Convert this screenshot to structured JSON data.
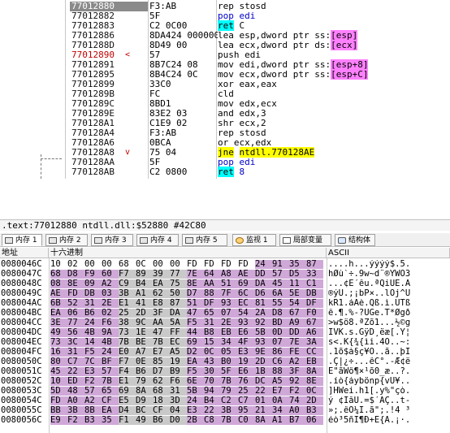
{
  "disassembly": {
    "rows": [
      {
        "addr": "77012880",
        "hex": "F3:AB",
        "ins": [
          [
            "rep stosd",
            ""
          ]
        ],
        "sel": true
      },
      {
        "addr": "77012882",
        "hex": "5F",
        "ins": [
          [
            "pop ",
            "op-blue"
          ],
          [
            "edi",
            "op-blue"
          ]
        ]
      },
      {
        "addr": "77012883",
        "hex": "C2 0C00",
        "ins": [
          [
            "ret",
            "retbox"
          ],
          [
            " C",
            ""
          ]
        ]
      },
      {
        "addr": "77012886",
        "hex": "8DA424 000000",
        "ins": [
          [
            "lea esp,dword ptr ss:",
            ""
          ],
          [
            "[esp]",
            "magenta"
          ]
        ]
      },
      {
        "addr": "7701288D",
        "hex": "8D49 00",
        "ins": [
          [
            "lea ecx,dword ptr ds:",
            ""
          ],
          [
            "[ecx]",
            "magenta"
          ]
        ]
      },
      {
        "addr": "77012890",
        "hex": "57",
        "ins": [
          [
            "push edi",
            ""
          ]
        ],
        "red": true,
        "mark": "<"
      },
      {
        "addr": "77012891",
        "hex": "8B7C24 08",
        "ins": [
          [
            "mov edi,dword ptr ss:",
            ""
          ],
          [
            "[esp+8]",
            "magenta"
          ]
        ]
      },
      {
        "addr": "77012895",
        "hex": "8B4C24 0C",
        "ins": [
          [
            "mov ecx,dword ptr ss:",
            ""
          ],
          [
            "[esp+C]",
            "magenta"
          ]
        ]
      },
      {
        "addr": "77012899",
        "hex": "33C0",
        "ins": [
          [
            "xor eax,eax",
            ""
          ]
        ]
      },
      {
        "addr": "7701289B",
        "hex": "FC",
        "ins": [
          [
            "cld",
            ""
          ]
        ]
      },
      {
        "addr": "7701289C",
        "hex": "8BD1",
        "ins": [
          [
            "mov edx,ecx",
            ""
          ]
        ]
      },
      {
        "addr": "7701289E",
        "hex": "83E2 03",
        "ins": [
          [
            "and edx,3",
            ""
          ]
        ]
      },
      {
        "addr": "770128A1",
        "hex": "C1E9 02",
        "ins": [
          [
            "shr ecx,2",
            ""
          ]
        ]
      },
      {
        "addr": "770128A4",
        "hex": "F3:AB",
        "ins": [
          [
            "rep stosd",
            ""
          ]
        ]
      },
      {
        "addr": "770128A6",
        "hex": "0BCA",
        "ins": [
          [
            "or ecx,edx",
            ""
          ]
        ]
      },
      {
        "addr": "770128A8",
        "hex": "75 04",
        "ins": [
          [
            "jne",
            "jmp"
          ],
          [
            " ",
            ""
          ],
          [
            "ntdll.770128AE",
            "jmp"
          ]
        ],
        "mark": "v"
      },
      {
        "addr": "770128AA",
        "hex": "5F",
        "ins": [
          [
            "pop edi",
            "op-blue"
          ]
        ]
      },
      {
        "addr": "770128AB",
        "hex": "C2 0800",
        "ins": [
          [
            "ret",
            "retbox"
          ],
          [
            " 8",
            "op-blue"
          ]
        ]
      }
    ]
  },
  "infoline": ".text:77012880 ntdll.dll:$52880 #42C80",
  "tabs": [
    {
      "label": "内存 1",
      "icon": "memory-icon"
    },
    {
      "label": "内存 2",
      "icon": "memory-icon"
    },
    {
      "label": "内存 3",
      "icon": "memory-icon"
    },
    {
      "label": "内存 4",
      "icon": "memory-icon"
    },
    {
      "label": "内存 5",
      "icon": "memory-icon"
    },
    {
      "label": "监视 1",
      "icon": "watch-icon"
    },
    {
      "label": "局部变量",
      "icon": "locals-icon"
    },
    {
      "label": "结构体",
      "icon": "struct-icon"
    }
  ],
  "dump": {
    "headers": {
      "address": "地址",
      "hex": "十六进制",
      "ascii": "ASCII"
    },
    "rows": [
      {
        "addr": "0080046C",
        "bytes": [
          "10",
          "02",
          "00",
          "00",
          "68",
          "0C",
          "00",
          "00",
          "FD",
          "FD",
          "FD",
          "FD",
          "24",
          "91",
          "35",
          "87"
        ],
        "ascii": "....h...ýýýý$.5."
      },
      {
        "addr": "0080047C",
        "bytes": [
          "68",
          "D8",
          "F9",
          "60",
          "F7",
          "89",
          "39",
          "77",
          "7E",
          "64",
          "A8",
          "AE",
          "DD",
          "57",
          "D5",
          "33"
        ],
        "ascii": "hØù`÷.9w~d¨®ÝWÕ3"
      },
      {
        "addr": "0080048C",
        "bytes": [
          "08",
          "8E",
          "09",
          "A2",
          "C9",
          "B4",
          "EA",
          "75",
          "8E",
          "AA",
          "51",
          "69",
          "DA",
          "45",
          "11",
          "C1"
        ],
        "ascii": "...¢É´êu.ªQiÚE.Á"
      },
      {
        "addr": "0080049C",
        "bytes": [
          "AE",
          "FD",
          "DB",
          "03",
          "3B",
          "A1",
          "62",
          "50",
          "D7",
          "88",
          "7F",
          "6C",
          "D6",
          "6A",
          "5E",
          "DB"
        ],
        "ascii": "®ýÛ.;¡bP×..lÖj^Û"
      },
      {
        "addr": "008004AC",
        "bytes": [
          "6B",
          "52",
          "31",
          "2E",
          "E1",
          "41",
          "E8",
          "87",
          "51",
          "DF",
          "93",
          "EC",
          "81",
          "55",
          "54",
          "DF"
        ],
        "ascii": "kR1.áAè.Qß.ì.UTß"
      },
      {
        "addr": "008004BC",
        "bytes": [
          "EA",
          "06",
          "B6",
          "02",
          "25",
          "2D",
          "3F",
          "DA",
          "47",
          "65",
          "07",
          "54",
          "2A",
          "D8",
          "67",
          "F0"
        ],
        "ascii": "ê.¶.%-?ÚGe.T*Øgð"
      },
      {
        "addr": "008004CC",
        "bytes": [
          "3E",
          "77",
          "24",
          "F6",
          "38",
          "9C",
          "AA",
          "5A",
          "F5",
          "31",
          "2E",
          "93",
          "92",
          "BD",
          "A9",
          "67"
        ],
        "ascii": ">w$ö8.ªZõ1...½©g"
      },
      {
        "addr": "008004DC",
        "bytes": [
          "49",
          "56",
          "4B",
          "9A",
          "73",
          "1E",
          "47",
          "FF",
          "44",
          "B8",
          "EB",
          "E6",
          "5B",
          "0D",
          "DD",
          "A6"
        ],
        "ascii": "IVK.s.GÿD¸ëæ[.Ý¦"
      },
      {
        "addr": "008004EC",
        "bytes": [
          "73",
          "3C",
          "14",
          "4B",
          "7B",
          "BE",
          "7B",
          "EC",
          "69",
          "15",
          "34",
          "4F",
          "93",
          "07",
          "7E",
          "3A"
        ],
        "ascii": "s<.K{¾{ìi.4O..~:"
      },
      {
        "addr": "008004FC",
        "bytes": [
          "16",
          "31",
          "F5",
          "24",
          "E0",
          "A7",
          "E7",
          "A5",
          "D2",
          "0C",
          "05",
          "E3",
          "9E",
          "86",
          "FE",
          "CC"
        ],
        "ascii": ".1õ$à§ç¥Ò..ã..þÌ"
      },
      {
        "addr": "0080050C",
        "bytes": [
          "80",
          "C7",
          "7C",
          "BF",
          "F7",
          "0E",
          "85",
          "19",
          "EA",
          "43",
          "B0",
          "19",
          "2D",
          "C6",
          "A2",
          "EB"
        ],
        "ascii": ".Ç|¿÷...êC°.-Æ¢ë"
      },
      {
        "addr": "0080051C",
        "bytes": [
          "45",
          "22",
          "E3",
          "57",
          "F4",
          "B6",
          "D7",
          "B9",
          "F5",
          "30",
          "5F",
          "E6",
          "1B",
          "88",
          "3F",
          "8A"
        ],
        "ascii": "E\"ãWô¶×¹õ0_æ..?."
      },
      {
        "addr": "0080052C",
        "bytes": [
          "10",
          "ED",
          "F2",
          "7B",
          "E1",
          "79",
          "62",
          "F6",
          "6E",
          "70",
          "7B",
          "76",
          "DC",
          "A5",
          "92",
          "8E"
        ],
        "ascii": ".íò{áybönp{vÜ¥.."
      },
      {
        "addr": "0080053C",
        "bytes": [
          "5D",
          "48",
          "57",
          "65",
          "69",
          "8A",
          "68",
          "31",
          "5B",
          "94",
          "79",
          "25",
          "22",
          "E7",
          "F2",
          "0C"
        ],
        "ascii": "]HWei.h1[.y%\"çò."
      },
      {
        "addr": "0080054C",
        "bytes": [
          "FD",
          "A0",
          "A2",
          "CF",
          "E5",
          "D9",
          "18",
          "3D",
          "24",
          "B4",
          "C2",
          "C7",
          "01",
          "0A",
          "74",
          "2D"
        ],
        "ascii": "ý ¢ÏåÙ.=$´ÂÇ..t-"
      },
      {
        "addr": "0080055C",
        "bytes": [
          "BB",
          "3B",
          "8B",
          "EA",
          "D4",
          "BC",
          "CF",
          "04",
          "E3",
          "22",
          "3B",
          "95",
          "21",
          "34",
          "A0",
          "B3"
        ],
        "ascii": "»;.êÔ¼Ï.ã\";.!4 ³"
      },
      {
        "addr": "0080056C",
        "bytes": [
          "E9",
          "F2",
          "B3",
          "35",
          "F1",
          "49",
          "B6",
          "D0",
          "2B",
          "C8",
          "7B",
          "C0",
          "8A",
          "A1",
          "B7",
          "06"
        ],
        "ascii": "éò³5ñI¶Ð+È{À.¡·."
      }
    ]
  }
}
